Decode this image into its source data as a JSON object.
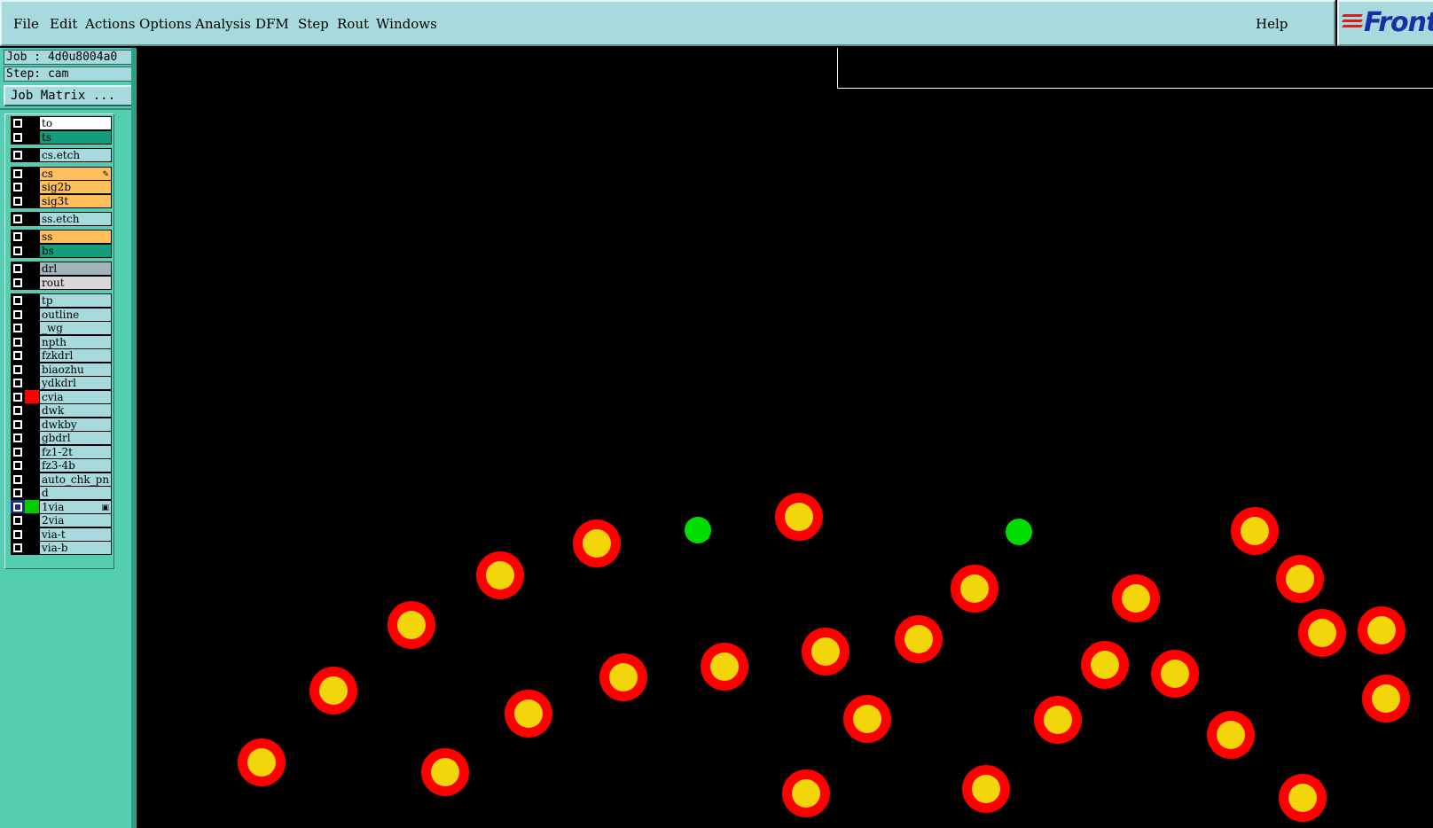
{
  "menubar": {
    "items": [
      "File",
      "Edit",
      "Actions",
      "Options",
      "Analysis",
      "DFM",
      "Step",
      "Rout",
      "Windows"
    ],
    "help": "Help"
  },
  "logo": {
    "text": "Front"
  },
  "job": {
    "label": "Job : 4d0u8004a0",
    "step": "Step: cam"
  },
  "job_matrix_button": "Job Matrix ...",
  "layers": [
    {
      "name": "to",
      "color": "#ffffff",
      "affected": "",
      "mark": ""
    },
    {
      "name": "ts",
      "color": "#159c7a",
      "affected": "",
      "mark": ""
    },
    {
      "name": "cs.etch",
      "color": "#a6dadc",
      "affected": "",
      "mark": ""
    },
    {
      "name": "cs",
      "color": "#ffc05c",
      "affected": "",
      "mark": "pencil"
    },
    {
      "name": "sig2b",
      "color": "#ffc05c",
      "affected": "",
      "mark": ""
    },
    {
      "name": "sig3t",
      "color": "#ffc05c",
      "affected": "",
      "mark": ""
    },
    {
      "name": "ss.etch",
      "color": "#a6dadc",
      "affected": "",
      "mark": ""
    },
    {
      "name": "ss",
      "color": "#ffc05c",
      "affected": "",
      "mark": ""
    },
    {
      "name": "bs",
      "color": "#159c7a",
      "affected": "",
      "mark": ""
    },
    {
      "name": "drl",
      "color": "#a0b4bc",
      "affected": "",
      "mark": ""
    },
    {
      "name": "rout",
      "color": "#d8d8d8",
      "affected": "",
      "mark": ""
    },
    {
      "name": "tp",
      "color": "#a6dadc",
      "affected": "",
      "mark": ""
    },
    {
      "name": "outline",
      "color": "#a6dadc",
      "affected": "",
      "mark": ""
    },
    {
      "name": "_wg",
      "color": "#a6dadc",
      "affected": "",
      "mark": ""
    },
    {
      "name": "npth",
      "color": "#a6dadc",
      "affected": "",
      "mark": ""
    },
    {
      "name": "fzkdrl",
      "color": "#a6dadc",
      "affected": "",
      "mark": ""
    },
    {
      "name": "biaozhu",
      "color": "#a6dadc",
      "affected": "",
      "mark": ""
    },
    {
      "name": "ydkdrl",
      "color": "#a6dadc",
      "affected": "",
      "mark": ""
    },
    {
      "name": "cvia",
      "color": "#a6dadc",
      "affected": "#ff0000",
      "mark": ""
    },
    {
      "name": "dwk",
      "color": "#a6dadc",
      "affected": "",
      "mark": ""
    },
    {
      "name": "dwkby",
      "color": "#a6dadc",
      "affected": "",
      "mark": ""
    },
    {
      "name": "gbdrl",
      "color": "#a6dadc",
      "affected": "",
      "mark": ""
    },
    {
      "name": "fz1-2t",
      "color": "#a6dadc",
      "affected": "",
      "mark": ""
    },
    {
      "name": "fz3-4b",
      "color": "#a6dadc",
      "affected": "",
      "mark": ""
    },
    {
      "name": "auto_chk_pn",
      "color": "#a6dadc",
      "affected": "",
      "mark": ""
    },
    {
      "name": "d",
      "color": "#a6dadc",
      "affected": "",
      "mark": ""
    },
    {
      "name": "1via",
      "color": "#a6dadc",
      "affected": "#00cc00",
      "mark": "work",
      "active": true
    },
    {
      "name": "2via",
      "color": "#a6dadc",
      "affected": "",
      "mark": ""
    },
    {
      "name": "via-t",
      "color": "#a6dadc",
      "affected": "",
      "mark": ""
    },
    {
      "name": "via-b",
      "color": "#a6dadc",
      "affected": "",
      "mark": ""
    }
  ],
  "colors": {
    "pad_outer": "#ff0000",
    "pad_inner": "#f2d50a",
    "via_green": "#00dd00",
    "background": "#000000"
  }
}
